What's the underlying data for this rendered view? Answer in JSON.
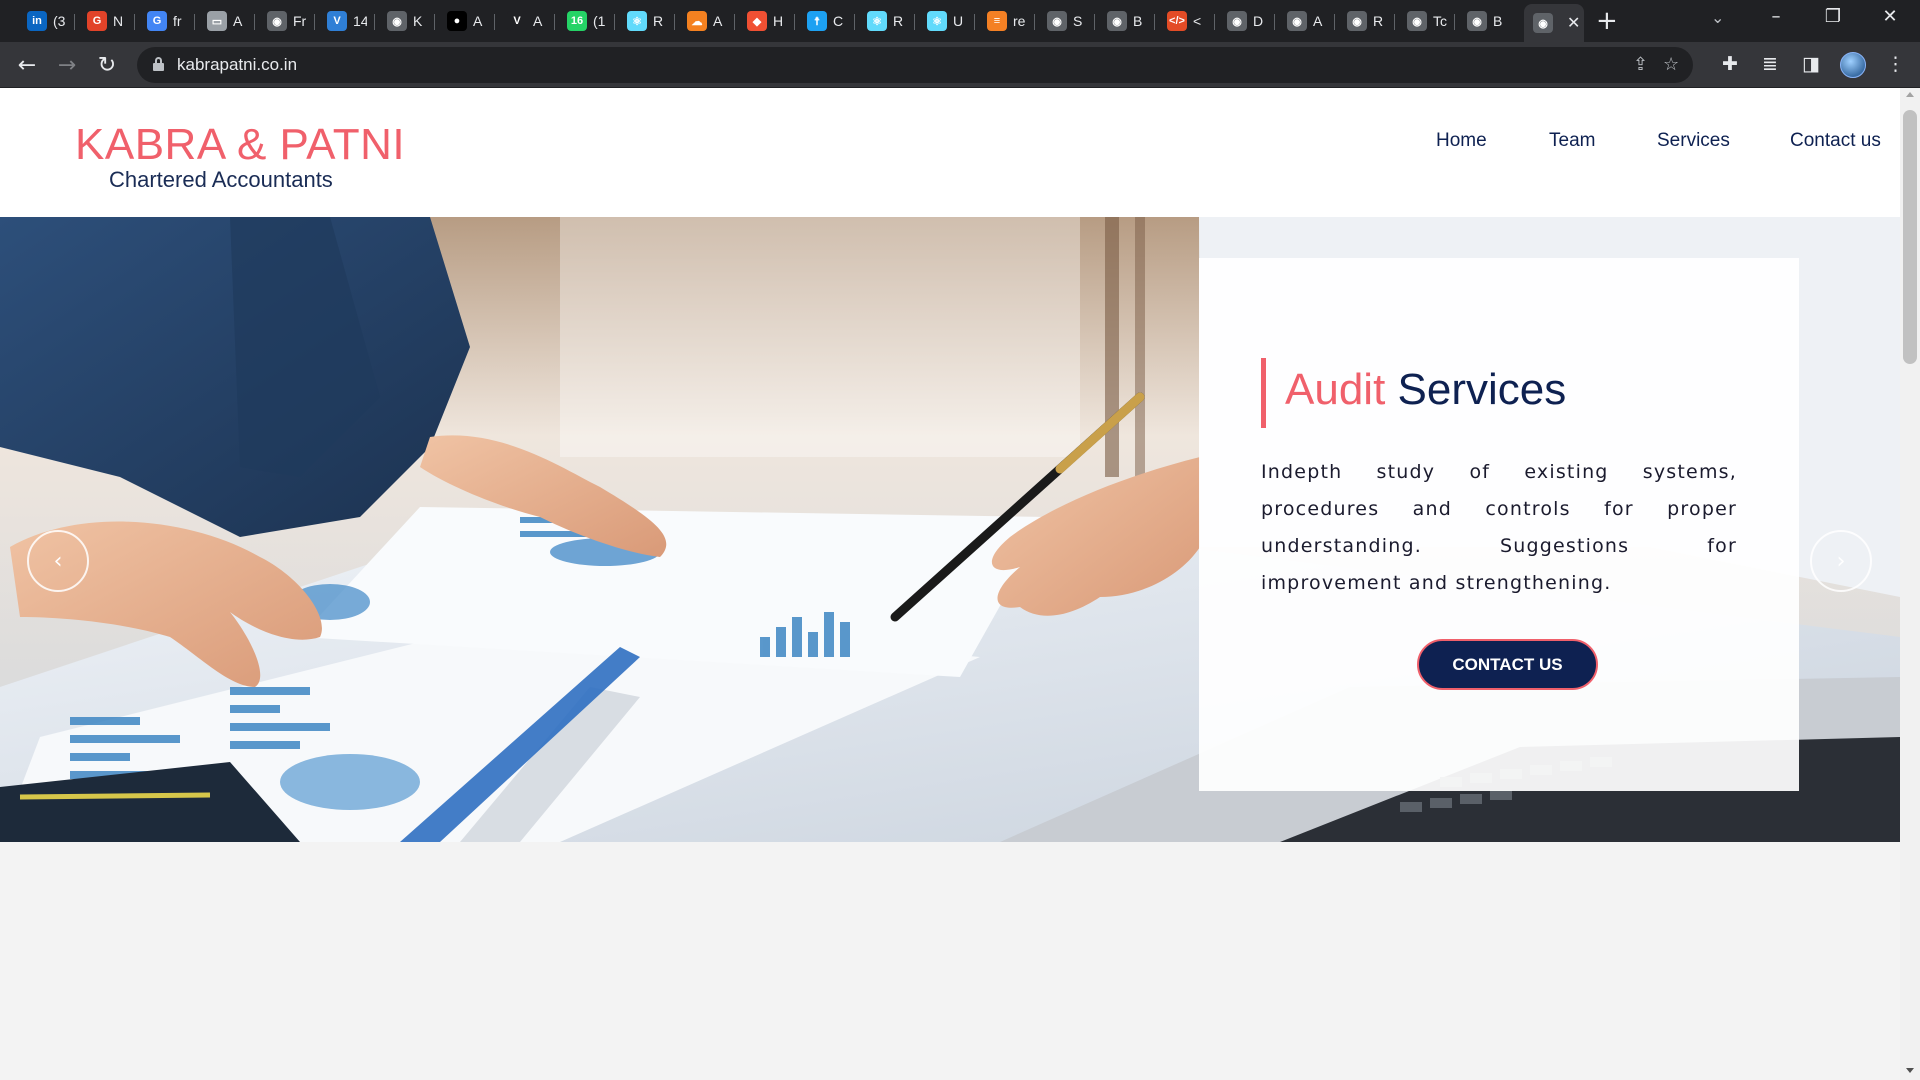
{
  "browser": {
    "tabs": [
      {
        "label": "(3",
        "icon": "linkedin-icon",
        "color": "#0a66c2",
        "glyph": "in"
      },
      {
        "label": "N",
        "icon": "gitlab-icon",
        "color": "#e24329",
        "glyph": "G"
      },
      {
        "label": "fr",
        "icon": "google-icon",
        "color": "#4285f4",
        "glyph": "G"
      },
      {
        "label": "A",
        "icon": "card-icon",
        "color": "#9aa0a6",
        "glyph": "▭"
      },
      {
        "label": "Fr",
        "icon": "globe-icon",
        "color": "#5f6368",
        "glyph": "◉"
      },
      {
        "label": "14",
        "icon": "vscode-icon",
        "color": "#2f7fd6",
        "glyph": "V"
      },
      {
        "label": "K",
        "icon": "globe-icon",
        "color": "#5f6368",
        "glyph": "◉"
      },
      {
        "label": "A",
        "icon": "github-icon",
        "color": "#000000",
        "glyph": "●"
      },
      {
        "label": "A",
        "icon": "vercel-icon",
        "color": "#202124",
        "glyph": "V"
      },
      {
        "label": "(1",
        "icon": "whatsapp-icon",
        "color": "#25d366",
        "glyph": "16"
      },
      {
        "label": "R",
        "icon": "react-icon",
        "color": "#61dafb",
        "glyph": "⚛"
      },
      {
        "label": "A",
        "icon": "cloud-icon",
        "color": "#f48120",
        "glyph": "☁"
      },
      {
        "label": "H",
        "icon": "git-icon",
        "color": "#f05033",
        "glyph": "◆"
      },
      {
        "label": "C",
        "icon": "person-icon",
        "color": "#1da1f2",
        "glyph": "☨"
      },
      {
        "label": "R",
        "icon": "react-icon",
        "color": "#61dafb",
        "glyph": "⚛"
      },
      {
        "label": "U",
        "icon": "react-icon",
        "color": "#61dafb",
        "glyph": "⚛"
      },
      {
        "label": "re",
        "icon": "stackoverflow-icon",
        "color": "#f48024",
        "glyph": "≡"
      },
      {
        "label": "S",
        "icon": "globe-icon",
        "color": "#5f6368",
        "glyph": "◉"
      },
      {
        "label": "B",
        "icon": "globe-icon",
        "color": "#5f6368",
        "glyph": "◉"
      },
      {
        "label": "<",
        "icon": "code-icon",
        "color": "#e34c26",
        "glyph": "</>"
      },
      {
        "label": "D",
        "icon": "globe-icon",
        "color": "#5f6368",
        "glyph": "◉"
      },
      {
        "label": "A",
        "icon": "globe-icon",
        "color": "#5f6368",
        "glyph": "◉"
      },
      {
        "label": "R",
        "icon": "globe-icon",
        "color": "#5f6368",
        "glyph": "◉"
      },
      {
        "label": "Tc",
        "icon": "globe-icon",
        "color": "#5f6368",
        "glyph": "◉"
      },
      {
        "label": "B",
        "icon": "globe-icon",
        "color": "#5f6368",
        "glyph": "◉"
      }
    ],
    "active_tab": {
      "label": "",
      "icon": "globe-icon",
      "close": "✕"
    },
    "new_tab": "+",
    "tab_search": "⌄",
    "window": {
      "minimize": "–",
      "restore": "❐",
      "close": "✕"
    },
    "back": "←",
    "forward": "→",
    "reload": "↻",
    "url": "kabrapatni.co.in",
    "share": "⇪",
    "bookmark": "☆",
    "extensions": "✚",
    "media": "≣",
    "sidepanel": "◨",
    "menu": "⋮"
  },
  "site": {
    "brand": {
      "title": "KABRA & PATNI",
      "subtitle": "Chartered Accountants"
    },
    "nav": [
      "Home",
      "Team",
      "Services",
      "Contact us"
    ],
    "hero": {
      "title_highlight": "Audit",
      "title_rest": "Services",
      "description": "Indepth study of existing systems, procedures and controls for proper understanding. Suggestions for improvement and strengthening.",
      "cta": "CONTACT US",
      "prev": "‹",
      "next": "›"
    },
    "colors": {
      "accent": "#f0606b",
      "navy": "#0e2151"
    }
  }
}
